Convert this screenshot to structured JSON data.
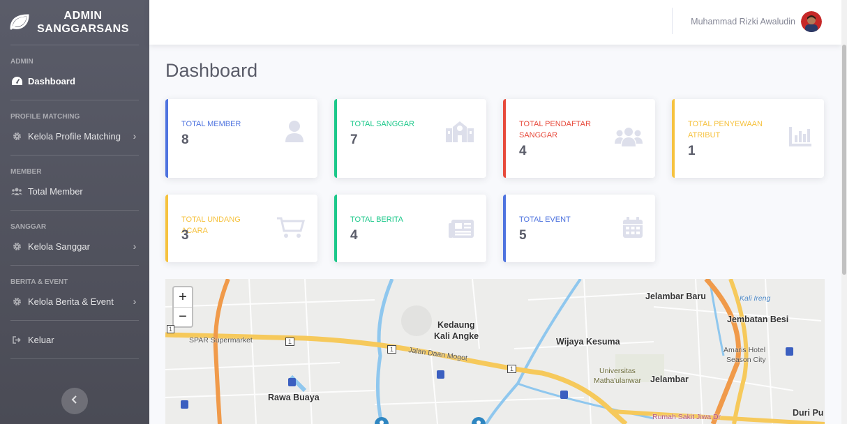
{
  "brand": {
    "line1": "ADMIN",
    "line2": "SANGGARSANS"
  },
  "sidebar": {
    "sections": [
      {
        "heading": "ADMIN"
      },
      {
        "heading": "PROFILE MATCHING"
      },
      {
        "heading": "MEMBER"
      },
      {
        "heading": "SANGGAR"
      },
      {
        "heading": "BERITA & EVENT"
      }
    ],
    "items": [
      {
        "label": "Dashboard",
        "icon": "tachometer-icon"
      },
      {
        "label": "Kelola Profile Matching",
        "icon": "cog-icon"
      },
      {
        "label": "Total Member",
        "icon": "users-icon"
      },
      {
        "label": "Kelola Sanggar",
        "icon": "cog-icon"
      },
      {
        "label": "Kelola Berita & Event",
        "icon": "cog-icon"
      },
      {
        "label": "Keluar",
        "icon": "sign-out-icon"
      }
    ]
  },
  "topbar": {
    "username": "Muhammad Rizki Awaludin"
  },
  "page": {
    "title": "Dashboard"
  },
  "cards": [
    {
      "label": "TOTAL MEMBER",
      "value": "8",
      "color": "#4e73df",
      "icon": "user-icon"
    },
    {
      "label": "TOTAL SANGGAR",
      "value": "7",
      "color": "#1cc88a",
      "icon": "school-icon"
    },
    {
      "label": "TOTAL PENDAFTAR SANGGAR",
      "value": "4",
      "color": "#e74a3b",
      "icon": "users-icon"
    },
    {
      "label": "TOTAL PENYEWAAN ATRIBUT",
      "value": "1",
      "color": "#f6c23e",
      "icon": "bar-chart-icon"
    },
    {
      "label": "TOTAL UNDANG ACARA",
      "value": "3",
      "color": "#f6c23e",
      "icon": "cart-icon"
    },
    {
      "label": "TOTAL BERITA",
      "value": "4",
      "color": "#1cc88a",
      "icon": "newspaper-icon"
    },
    {
      "label": "TOTAL EVENT",
      "value": "5",
      "color": "#4e73df",
      "icon": "calendar-icon"
    }
  ],
  "map": {
    "zoom_in": "+",
    "zoom_out": "−",
    "labels": {
      "jelambar_baru": "Jelambar Baru",
      "kali_ireng": "Kali Ireng",
      "jembatan_besi": "Jembatan Besi",
      "kedaung_1": "Kedaung",
      "kedaung_2": "Kali Angke",
      "wijaya_kesuma": "Wijaya Kesuma",
      "spar": "SPAR Supermarket",
      "jalan_daan_mogot": "Jalan Daan Mogot",
      "amaris_1": "Amaris Hotel",
      "amaris_2": "Season City",
      "universitas_1": "Universitas",
      "universitas_2": "Matha'ulanwar",
      "jelambar": "Jelambar",
      "rawa_buaya": "Rawa Buaya",
      "rumah_sakit": "Rumah Sakit Jiwa Dr",
      "duri": "Duri Pu",
      "road_1a": "1",
      "road_1b": "1",
      "road_1c": "1",
      "road_1d": "1"
    }
  }
}
